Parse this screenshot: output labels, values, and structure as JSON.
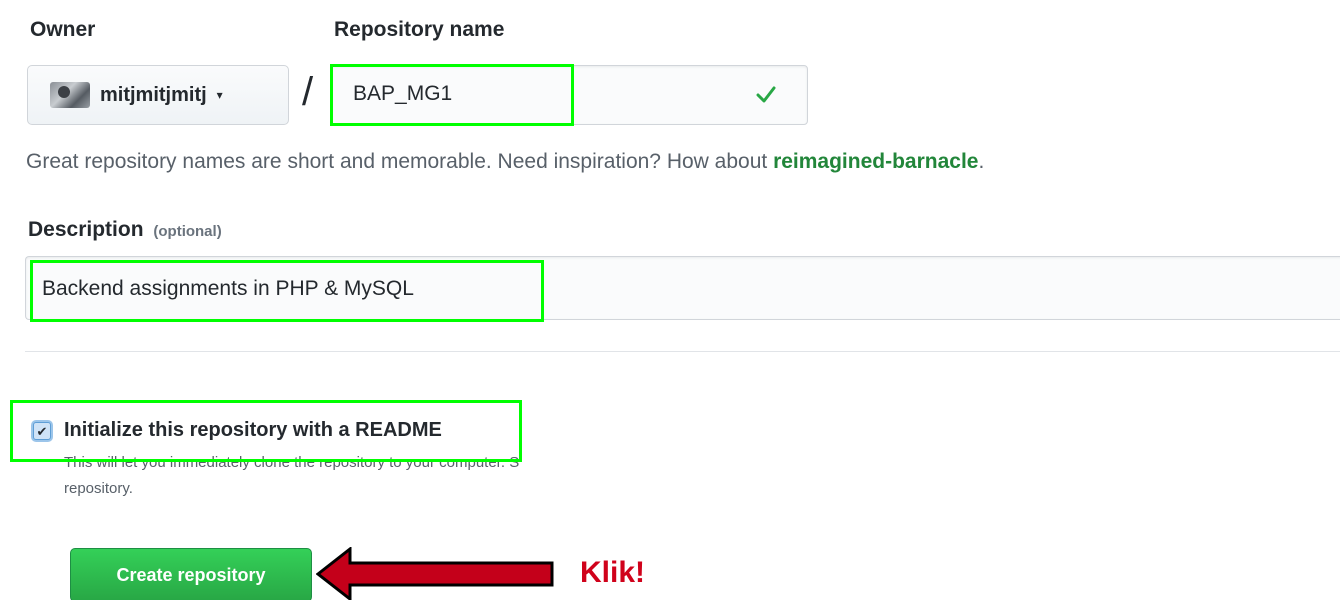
{
  "owner": {
    "label": "Owner",
    "selected": "mitjmitjmitj",
    "caret": "▾"
  },
  "separator": "/",
  "repository": {
    "label": "Repository name",
    "value": "BAP_MG1",
    "valid_icon": "check-icon"
  },
  "hint": {
    "text": "Great repository names are short and memorable. Need inspiration? How about ",
    "suggestion": "reimagined-barnacle",
    "end": "."
  },
  "description": {
    "label": "Description",
    "optional": "(optional)",
    "value": "Backend assignments in PHP & MySQL"
  },
  "readme": {
    "checked": true,
    "check_mark": "✔",
    "label": "Initialize this repository with a README",
    "note_line1": "This will let you immediately clone the repository to your computer. S",
    "note_line2": "repository."
  },
  "create_button": {
    "label": "Create repository"
  },
  "annotation": {
    "text": "Klik!",
    "highlight_color": "#00ff00",
    "arrow_color": "#d0021b"
  },
  "colors": {
    "button_green": "#28a745",
    "link_green": "#22863a"
  }
}
